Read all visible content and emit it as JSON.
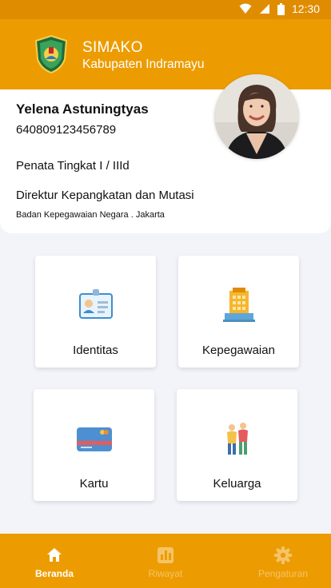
{
  "status_bar": {
    "time": "12:30",
    "icons": [
      "wifi-icon",
      "signal-icon",
      "battery-icon"
    ]
  },
  "app_bar": {
    "title": "SIMAKO",
    "subtitle": "Kabupaten Indramayu",
    "logo_icon": "indramayu-emblem-icon"
  },
  "profile": {
    "name": "Yelena Astuningtyas",
    "nip": "640809123456789",
    "rank": "Penata Tingkat I / IIId",
    "position": "Direktur Kepangkatan dan Mutasi",
    "office": "Badan Kepegawaian Negara . Jakarta",
    "avatar_icon": "user-photo"
  },
  "menu": [
    {
      "label": "Identitas",
      "icon": "id-card-icon"
    },
    {
      "label": "Kepegawaian",
      "icon": "office-building-icon"
    },
    {
      "label": "Kartu",
      "icon": "credit-card-icon"
    },
    {
      "label": "Keluarga",
      "icon": "family-icon"
    }
  ],
  "bottom_nav": [
    {
      "label": "Beranda",
      "icon": "home-icon",
      "active": true
    },
    {
      "label": "Riwayat",
      "icon": "bar-chart-icon",
      "active": false
    },
    {
      "label": "Pengaturan",
      "icon": "gear-icon",
      "active": false
    }
  ],
  "colors": {
    "primary": "#ec9c00",
    "status_bar": "#e08c00",
    "background": "#f3f4f9",
    "nav_inactive": "#f6c367"
  }
}
